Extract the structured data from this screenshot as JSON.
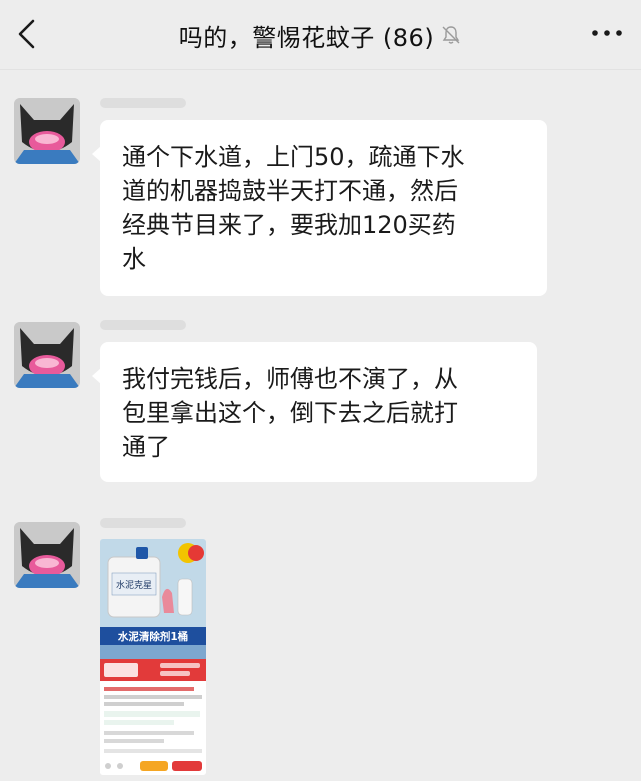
{
  "header": {
    "title": "吗的，警惕花蚊子 (86)",
    "back_icon": "chevron-left-icon",
    "mute_icon": "bell-slash-icon",
    "more_icon": "ellipsis-icon"
  },
  "messages": [
    {
      "type": "text",
      "lines": [
        "通个下水道，上门50，疏通下水",
        "道的机器捣鼓半天打不通，然后",
        "经典节目来了，要我加120买药",
        "水"
      ]
    },
    {
      "type": "text",
      "lines": [
        "我付完钱后，师傅也不演了，从",
        "包里拿出这个，倒下去之后就打",
        "通了"
      ]
    },
    {
      "type": "image",
      "product_title": "水泥清除剂1桶",
      "bottle_label": "水泥克星"
    }
  ],
  "colors": {
    "background": "#ededed",
    "bubble": "#ffffff",
    "text": "#1a1a1a",
    "product_banner": "#e23a3a"
  }
}
